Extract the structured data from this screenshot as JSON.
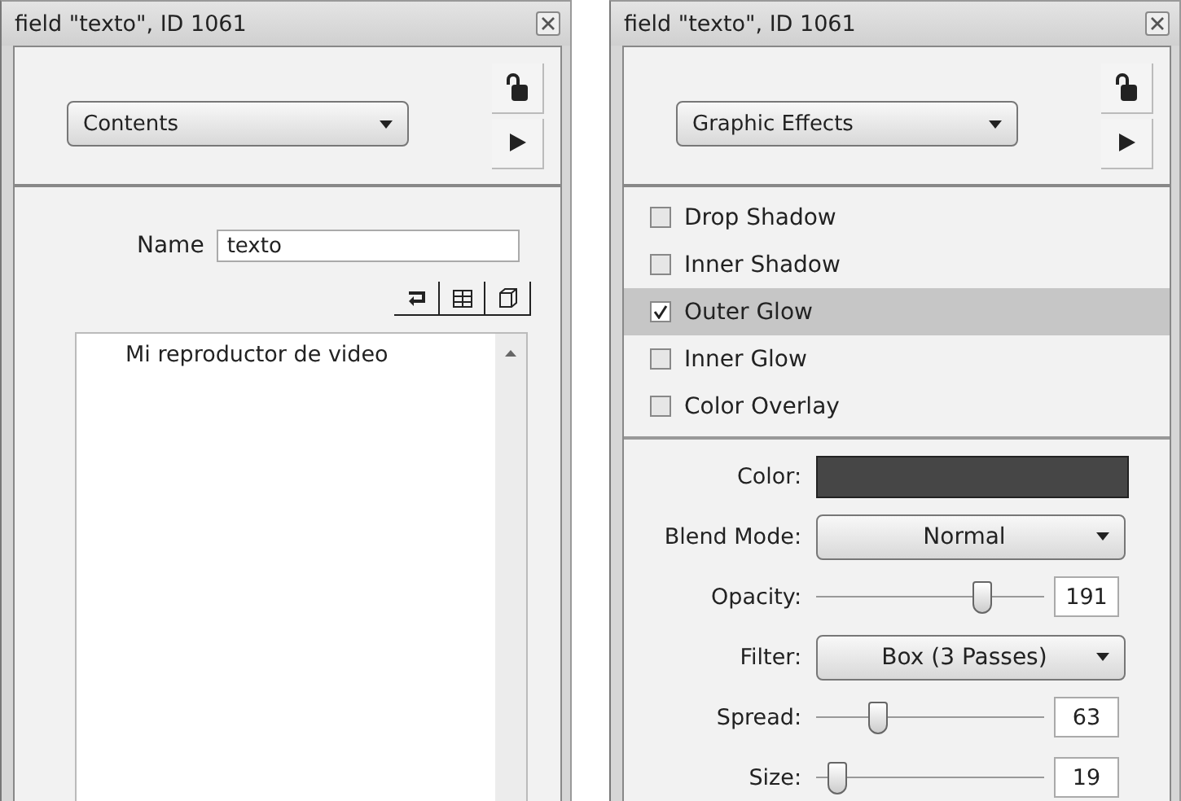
{
  "panels": [
    {
      "kind": "contents",
      "title": "field \"texto\", ID 1061",
      "mode": "Contents",
      "name_label": "Name",
      "name_value": "texto",
      "text_lines": [
        "Mi reproductor de video"
      ]
    },
    {
      "kind": "effects",
      "title": "field \"texto\", ID 1061",
      "mode": "Graphic Effects",
      "effects": [
        {
          "label": "Drop Shadow",
          "checked": false,
          "selected": false
        },
        {
          "label": "Inner Shadow",
          "checked": false,
          "selected": false
        },
        {
          "label": "Outer Glow",
          "checked": true,
          "selected": true
        },
        {
          "label": "Inner Glow",
          "checked": false,
          "selected": false
        },
        {
          "label": "Color Overlay",
          "checked": false,
          "selected": false
        }
      ],
      "settings": [
        {
          "kind": "color",
          "label": "Color:",
          "color": "#464646"
        },
        {
          "kind": "dropdown",
          "label": "Blend Mode:",
          "value": "Normal"
        },
        {
          "kind": "slider",
          "label": "Opacity:",
          "level": 0.73,
          "value": "191"
        },
        {
          "kind": "dropdown",
          "label": "Filter:",
          "value": "Box (3 Passes)"
        },
        {
          "kind": "slider",
          "label": "Spread:",
          "level": 0.27,
          "value": "63"
        },
        {
          "kind": "slider",
          "label": "Size:",
          "level": 0.09,
          "value": "19"
        }
      ]
    }
  ]
}
